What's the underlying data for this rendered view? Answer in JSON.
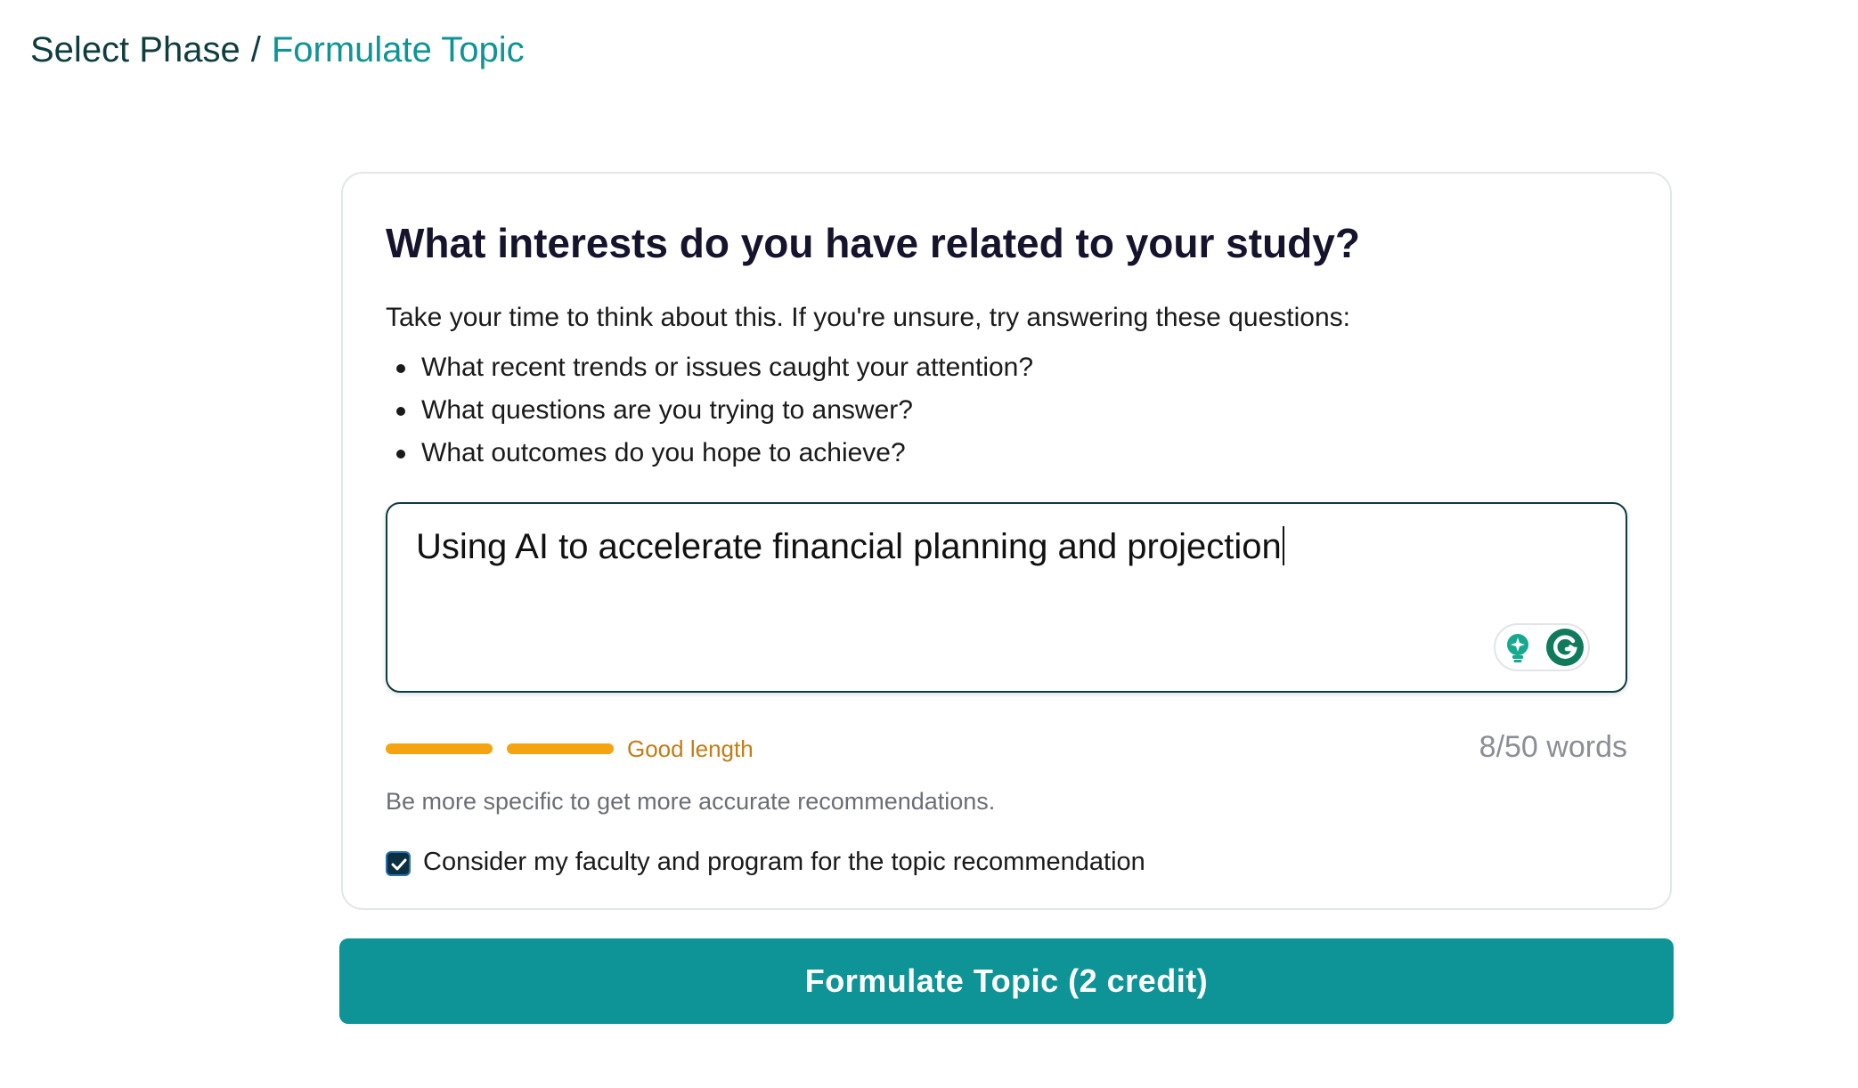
{
  "breadcrumb": {
    "parent": "Select Phase",
    "separator": "/",
    "current": "Formulate Topic"
  },
  "form": {
    "question": "What interests do you have related to your study?",
    "intro": "Take your time to think about this. If you're unsure, try answering these questions:",
    "hints": [
      "What recent trends or issues caught your attention?",
      "What questions are you trying to answer?",
      "What outcomes do you hope to achieve?"
    ],
    "answer_value": "Using AI to accelerate financial planning and projection",
    "length_status": "Good length",
    "length_bars_filled": 2,
    "word_count": "8/50 words",
    "specificity_hint": "Be more specific to get more accurate recommendations.",
    "checkbox_label": "Consider my faculty and program for the topic recommendation",
    "checkbox_checked": true,
    "submit_label": "Formulate Topic (2 credit)"
  },
  "icons": {
    "suggest": "lightbulb-icon",
    "grammarly": "grammarly-icon",
    "check": "checkmark-icon"
  },
  "colors": {
    "accent": "#0e9497",
    "dark": "#0f3d3e",
    "length_ok": "#f5a311",
    "length_text": "#c47c14"
  }
}
